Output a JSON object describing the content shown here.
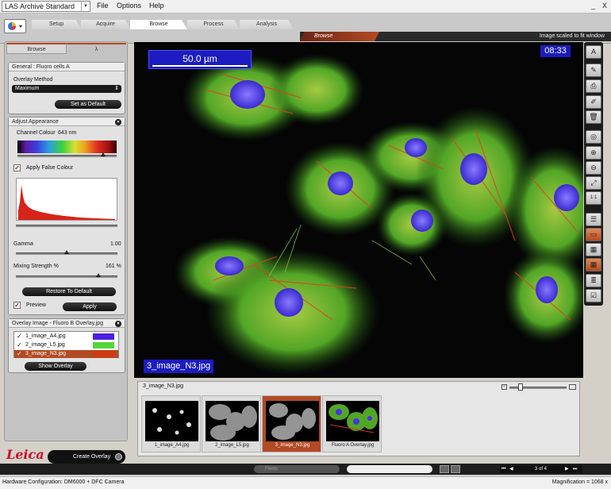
{
  "app": {
    "title": "LAS Archive Standard",
    "menus": [
      "File",
      "Options",
      "Help"
    ],
    "window_controls": [
      "_",
      "X"
    ]
  },
  "workflow": {
    "tabs": [
      "Setup",
      "Acquire",
      "Browse",
      "Process",
      "Analysis"
    ],
    "active": "Browse",
    "breadcrumb": "Browse",
    "scale_message": "Image scaled to fit window"
  },
  "left_tabs": {
    "browse": "Browse",
    "lambda": "λ"
  },
  "general": {
    "title": "General : Fluoro cells A",
    "overlay_method_label": "Overlay Method",
    "overlay_method_value": "Maximum",
    "set_default": "Set as Default"
  },
  "appearance": {
    "title": "Adjust Appearance",
    "channel_colour_label": "Channel Colour",
    "channel_wavelength": "643 nm",
    "false_colour_label": "Apply False Colour",
    "gamma_label": "Gamma",
    "gamma_value": "1.00",
    "mixing_label": "Mixing Strength %",
    "mixing_value": "161 %",
    "restore": "Restore To Default",
    "preview_label": "Preview",
    "apply": "Apply",
    "channel_level": 0.86,
    "gamma_level": 0.5,
    "mixing_level": 0.81
  },
  "overlay": {
    "title": "Overlay Image - Fluoro B Overlay.jpg",
    "items": [
      {
        "name": "1_image_A4.jpg",
        "color": "#4d1fe0"
      },
      {
        "name": "2_image_L5.jpg",
        "color": "#55d43c"
      },
      {
        "name": "3_image_N3.jpg",
        "color": "#d03a12"
      }
    ],
    "show": "Show Overlay"
  },
  "viewer": {
    "scale_bar": "50.0 µm",
    "time": "08:33",
    "image_name": "3_image_N3.jpg"
  },
  "filmstrip": {
    "header": "3_image_N3.jpg",
    "items": [
      "1_image_A4.jpg",
      "2_image_L5.jpg",
      "3_image_N3.jpg",
      "Fluoro A Overlay.jpg"
    ],
    "selected": "3_image_N3.jpg",
    "zoom_level": 0.2
  },
  "bottom": {
    "create_overlay": "Create Overlay",
    "logo": "Leica",
    "filter_placeholder": "Fields",
    "page_indicator": "3 of 4"
  },
  "status": {
    "hardware": "Hardware Configuration: DM6000 + DFC Camera",
    "magnification": "Magnification = 1068 x"
  },
  "colors": {
    "accent": "#b24a24",
    "viewer_bg": "#050506"
  }
}
